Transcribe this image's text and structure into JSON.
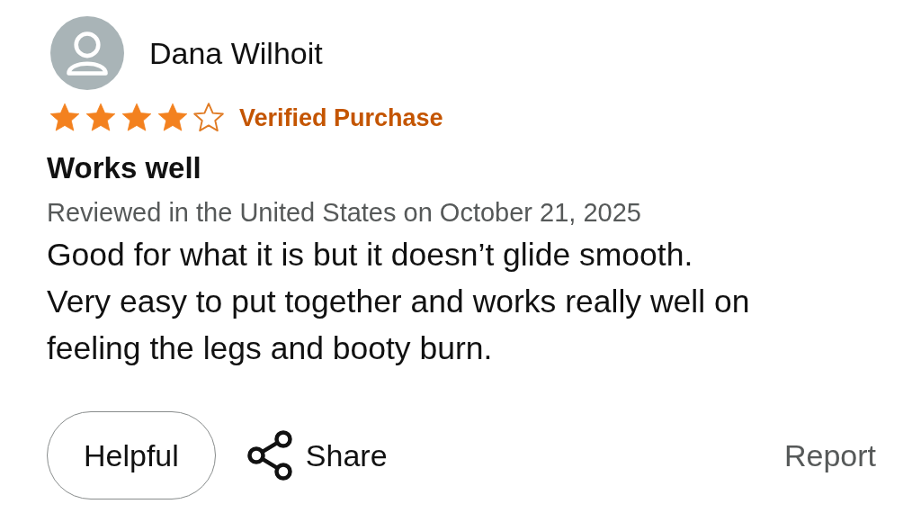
{
  "review": {
    "author": "Dana Wilhoit",
    "stars": 4,
    "badge": "Verified Purchase",
    "title": "Works well",
    "meta": "Reviewed in the United States on October 21, 2025",
    "body": [
      "Good for what it is but it doesn’t glide smooth.",
      "Very easy to put together and works really well on",
      "feeling the legs and booty burn."
    ]
  },
  "actions": {
    "helpful": "Helpful",
    "share": "Share",
    "report": "Report"
  }
}
